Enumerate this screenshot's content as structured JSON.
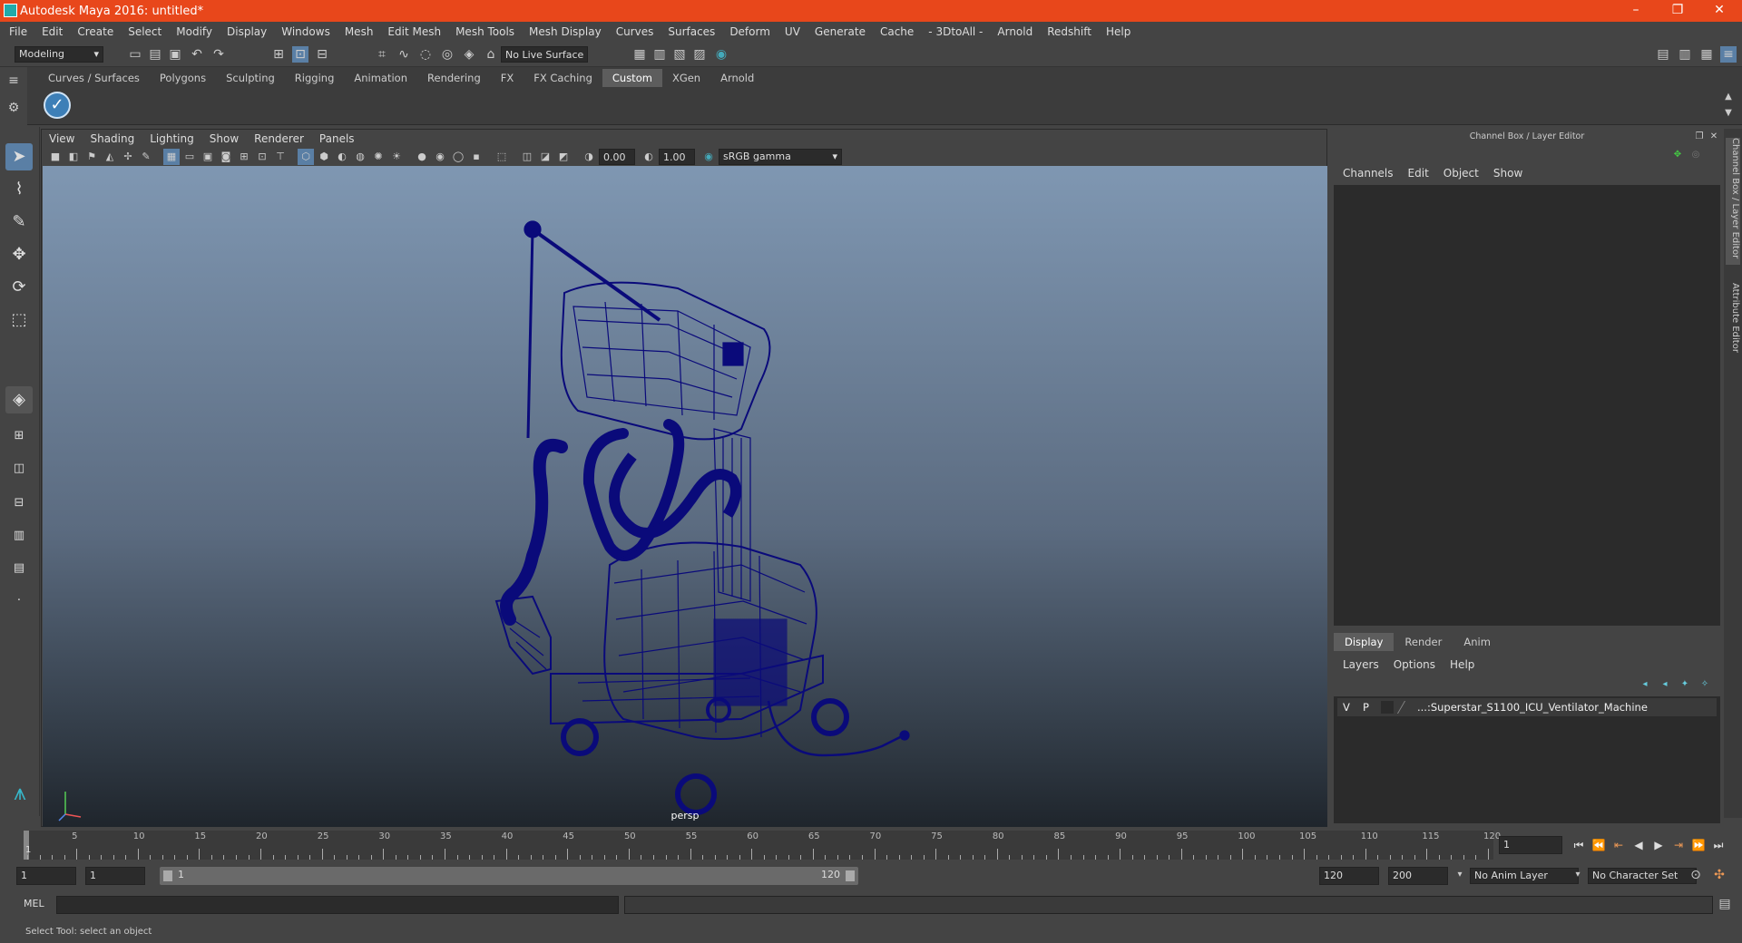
{
  "window": {
    "title": "Autodesk Maya 2016: untitled*",
    "minimize": "–",
    "maximize": "❐",
    "close": "✕"
  },
  "menubar": [
    "File",
    "Edit",
    "Create",
    "Select",
    "Modify",
    "Display",
    "Windows",
    "Mesh",
    "Edit Mesh",
    "Mesh Tools",
    "Mesh Display",
    "Curves",
    "Surfaces",
    "Deform",
    "UV",
    "Generate",
    "Cache",
    "- 3DtoAll -",
    "Arnold",
    "Redshift",
    "Help"
  ],
  "statusline": {
    "mode": "Modeling",
    "live_surface": "No Live Surface"
  },
  "shelf": {
    "tabs": [
      "Curves / Surfaces",
      "Polygons",
      "Sculpting",
      "Rigging",
      "Animation",
      "Rendering",
      "FX",
      "FX Caching",
      "Custom",
      "XGen",
      "Arnold"
    ],
    "active_tab": "Custom"
  },
  "viewport": {
    "menu": [
      "View",
      "Shading",
      "Lighting",
      "Show",
      "Renderer",
      "Panels"
    ],
    "exposure": "0.00",
    "gamma": "1.00",
    "colorspace": "sRGB gamma",
    "camera_label": "persp"
  },
  "channelbox": {
    "header": "Channel Box / Layer Editor",
    "menu": [
      "Channels",
      "Edit",
      "Object",
      "Show"
    ]
  },
  "layers": {
    "tabs": [
      "Display",
      "Render",
      "Anim"
    ],
    "active_tab": "Display",
    "menu": [
      "Layers",
      "Options",
      "Help"
    ],
    "rows": [
      {
        "v": "V",
        "p": "P",
        "name": "...:Superstar_S1100_ICU_Ventilator_Machine"
      }
    ]
  },
  "side_tabs": [
    "Channel Box / Layer Editor",
    "Attribute Editor"
  ],
  "timeline": {
    "ticks": [
      "5",
      "10",
      "15",
      "20",
      "25",
      "30",
      "35",
      "40",
      "45",
      "50",
      "55",
      "60",
      "65",
      "70",
      "75",
      "80",
      "85",
      "90",
      "95",
      "100",
      "105",
      "110",
      "115",
      "120"
    ],
    "current_frame": "1",
    "frame_field": "1"
  },
  "range": {
    "start": "1",
    "playback_start": "1",
    "slider_start": "1",
    "slider_end": "120",
    "playback_end": "120",
    "end": "200",
    "anim_layer": "No Anim Layer",
    "character_set": "No Character Set"
  },
  "cmdline": {
    "label": "MEL"
  },
  "helpline": {
    "text": "Select Tool: select an object"
  },
  "colors": {
    "titlebar": "#E8471B",
    "wire": "#0a0a7a",
    "bg": "#444444"
  }
}
